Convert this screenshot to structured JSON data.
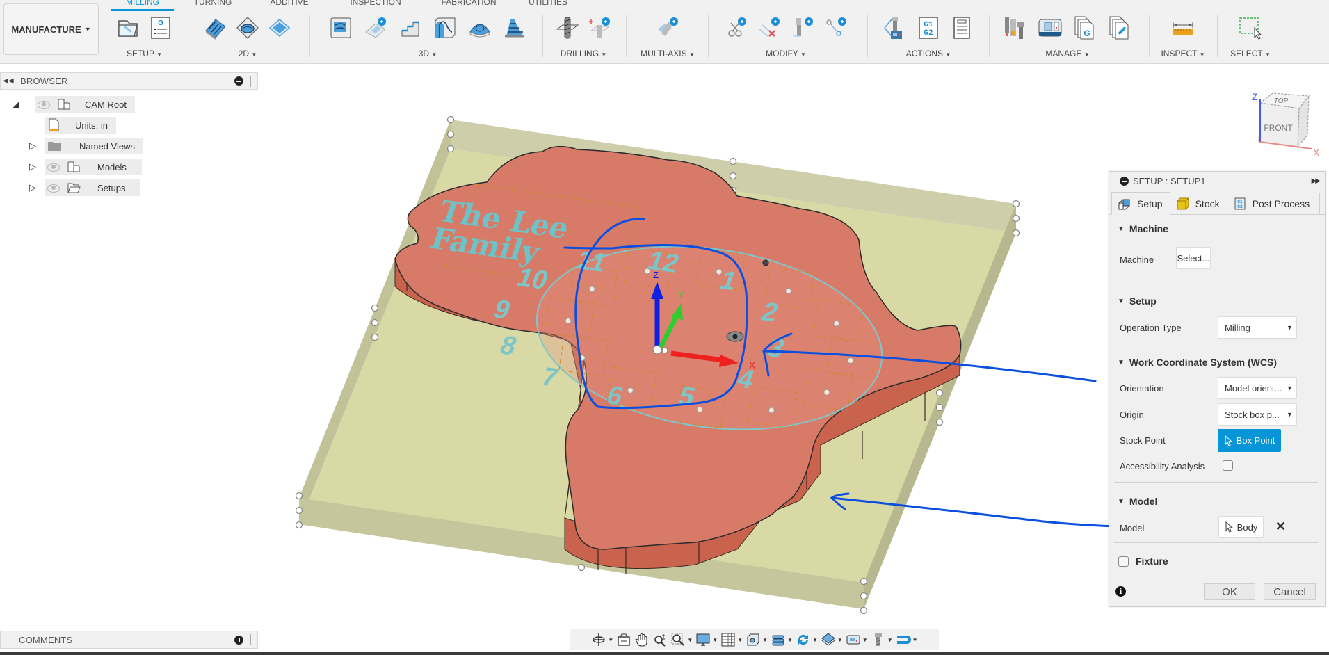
{
  "app": {
    "workspace": "MANUFACTURE",
    "tabs": [
      {
        "label": "MILLING",
        "active": true
      },
      {
        "label": "TURNING",
        "active": false
      },
      {
        "label": "ADDITIVE",
        "active": false
      },
      {
        "label": "INSPECTION",
        "active": false
      },
      {
        "label": "FABRICATION",
        "active": false
      },
      {
        "label": "UTILITIES",
        "active": false
      }
    ],
    "groups": [
      {
        "label": "SETUP",
        "icons": [
          "new-setup-icon",
          "nc-program-icon"
        ]
      },
      {
        "label": "2D",
        "icons": [
          "2d-adaptive-icon",
          "2d-pocket-icon",
          "face-icon"
        ]
      },
      {
        "label": "3D",
        "icons": [
          "3d-adaptive-icon",
          "3d-pocket-extension-icon",
          "steep-shallow-icon",
          "contour-icon",
          "pocket-icon",
          "horizontal-icon"
        ]
      },
      {
        "label": "DRILLING",
        "icons": [
          "drill-icon",
          "hole-recognition-icon"
        ]
      },
      {
        "label": "MULTI-AXIS",
        "icons": [
          "multi-axis-icon"
        ]
      },
      {
        "label": "MODIFY",
        "icons": [
          "cut-toolpath-icon",
          "delete-toolpath-icon",
          "tool-length-icon",
          "move-point-icon"
        ]
      },
      {
        "label": "ACTIONS",
        "icons": [
          "simulate-icon",
          "post-process-icon",
          "setup-sheet-icon"
        ]
      },
      {
        "label": "MANAGE",
        "icons": [
          "tool-library-icon",
          "machine-library-icon",
          "post-library-icon",
          "template-library-icon"
        ]
      },
      {
        "label": "INSPECT",
        "icons": [
          "measure-icon"
        ]
      },
      {
        "label": "SELECT",
        "icons": [
          "window-select-icon"
        ]
      }
    ],
    "colors": {
      "accent": "#0696d7",
      "stock": "#d9d9a6",
      "model_top": "#d87a68",
      "model_side": "#c9634e",
      "annotation": "#0a4fe0",
      "engraving": "#6ec3c8"
    }
  },
  "browser": {
    "title": "BROWSER",
    "items": [
      {
        "label": "CAM Root",
        "expander": "expanded",
        "icon": "component-icon",
        "eye": true
      },
      {
        "label": "Units: in",
        "expander": "none",
        "icon": "document-units-icon",
        "eye": false
      },
      {
        "label": "Named Views",
        "expander": "collapsed",
        "icon": "folder-icon",
        "eye": false
      },
      {
        "label": "Models",
        "expander": "collapsed",
        "icon": "component-icon",
        "eye": true
      },
      {
        "label": "Setups",
        "expander": "collapsed",
        "icon": "open-folder-icon",
        "eye": true
      }
    ]
  },
  "viewport": {
    "model_text": [
      "The Lee",
      "Family"
    ],
    "clock_numbers": [
      "12",
      "1",
      "2",
      "3",
      "4",
      "5",
      "6",
      "7",
      "8",
      "9",
      "10",
      "11"
    ],
    "axis_labels": {
      "x": "X",
      "y": "Y",
      "z": "Z"
    },
    "viewcube": {
      "top": "TOP",
      "front": "FRONT",
      "z": "Z",
      "x": "X"
    }
  },
  "dialog": {
    "title": "SETUP : SETUP1",
    "tabs": [
      {
        "label": "Setup",
        "active": true
      },
      {
        "label": "Stock",
        "active": false
      },
      {
        "label": "Post Process",
        "active": false
      }
    ],
    "sections": {
      "machine": {
        "title": "Machine",
        "machine_label": "Machine",
        "machine_button": "Select..."
      },
      "setup": {
        "title": "Setup",
        "operation_type_label": "Operation Type",
        "operation_type_value": "Milling"
      },
      "wcs": {
        "title": "Work Coordinate System (WCS)",
        "orientation_label": "Orientation",
        "orientation_value": "Model orient...",
        "origin_label": "Origin",
        "origin_value": "Stock box p...",
        "stock_point_label": "Stock Point",
        "stock_point_button": "Box Point",
        "accessibility_label": "Accessibility Analysis",
        "accessibility_checked": false
      },
      "model": {
        "title": "Model",
        "model_label": "Model",
        "model_button": "Body"
      },
      "fixture": {
        "title": "Fixture",
        "checked": false
      }
    },
    "ok_label": "OK",
    "cancel_label": "Cancel"
  },
  "comments": {
    "title": "COMMENTS"
  },
  "navbar": {
    "items": [
      "orbit-icon",
      "look-at-icon",
      "pan-icon",
      "zoom-icon",
      "fit-icon",
      "display-settings-icon",
      "grid-icon",
      "visual-style-icon",
      "section-icon",
      "refresh-icon",
      "stock-display-icon",
      "machine-display-icon",
      "tool-display-icon",
      "toolpath-display-icon"
    ]
  }
}
